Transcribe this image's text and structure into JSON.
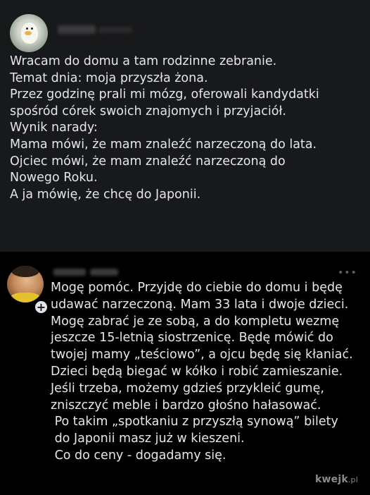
{
  "post": {
    "lines": [
      "Wracam do domu a tam rodzinne zebranie.",
      "Temat dnia: moja przyszła żona.",
      "Przez godzinę prali mi mózg, oferowali kandydatki",
      "spośród córek swoich znajomych i przyjaciół.",
      "Wynik narady:",
      "Mama mówi, że mam znaleźć narzeczoną do lata.",
      "Ojciec mówi, że mam znaleźć narzeczoną do",
      "Nowego Roku.",
      "A ja mówię, że chcę do Japonii."
    ]
  },
  "comment": {
    "more_icon": "more-options-icon",
    "badge_symbol": "+",
    "lines": [
      "Mogę pomóc. Przyjdę do ciebie do domu i będę",
      "udawać narzeczoną. Mam 33 lata i dwoje dzieci.",
      "Mogę zabrać je ze sobą, a do kompletu wezmę",
      "jeszcze 15-letnią siostrzenicę. Będę mówić do",
      "twojej mamy „teściowo”, a ojcu będę się kłaniać.",
      "Dzieci będą biegać w kółko i robić zamieszanie.",
      "Jeśli trzeba, możemy gdzieś przykleić gumę,",
      "zniszczyć meble i bardzo głośno hałasować.",
      " Po takim „spotkaniu z przyszłą synową” bilety",
      " do Japonii masz już w kieszeni.",
      " Co do ceny - dogadamy się."
    ]
  },
  "watermark": {
    "brand": "kwejk",
    "tld": ".pl"
  },
  "colors": {
    "post_background": "#18191a",
    "comment_background": "#000000",
    "text": "#e4e6eb"
  }
}
